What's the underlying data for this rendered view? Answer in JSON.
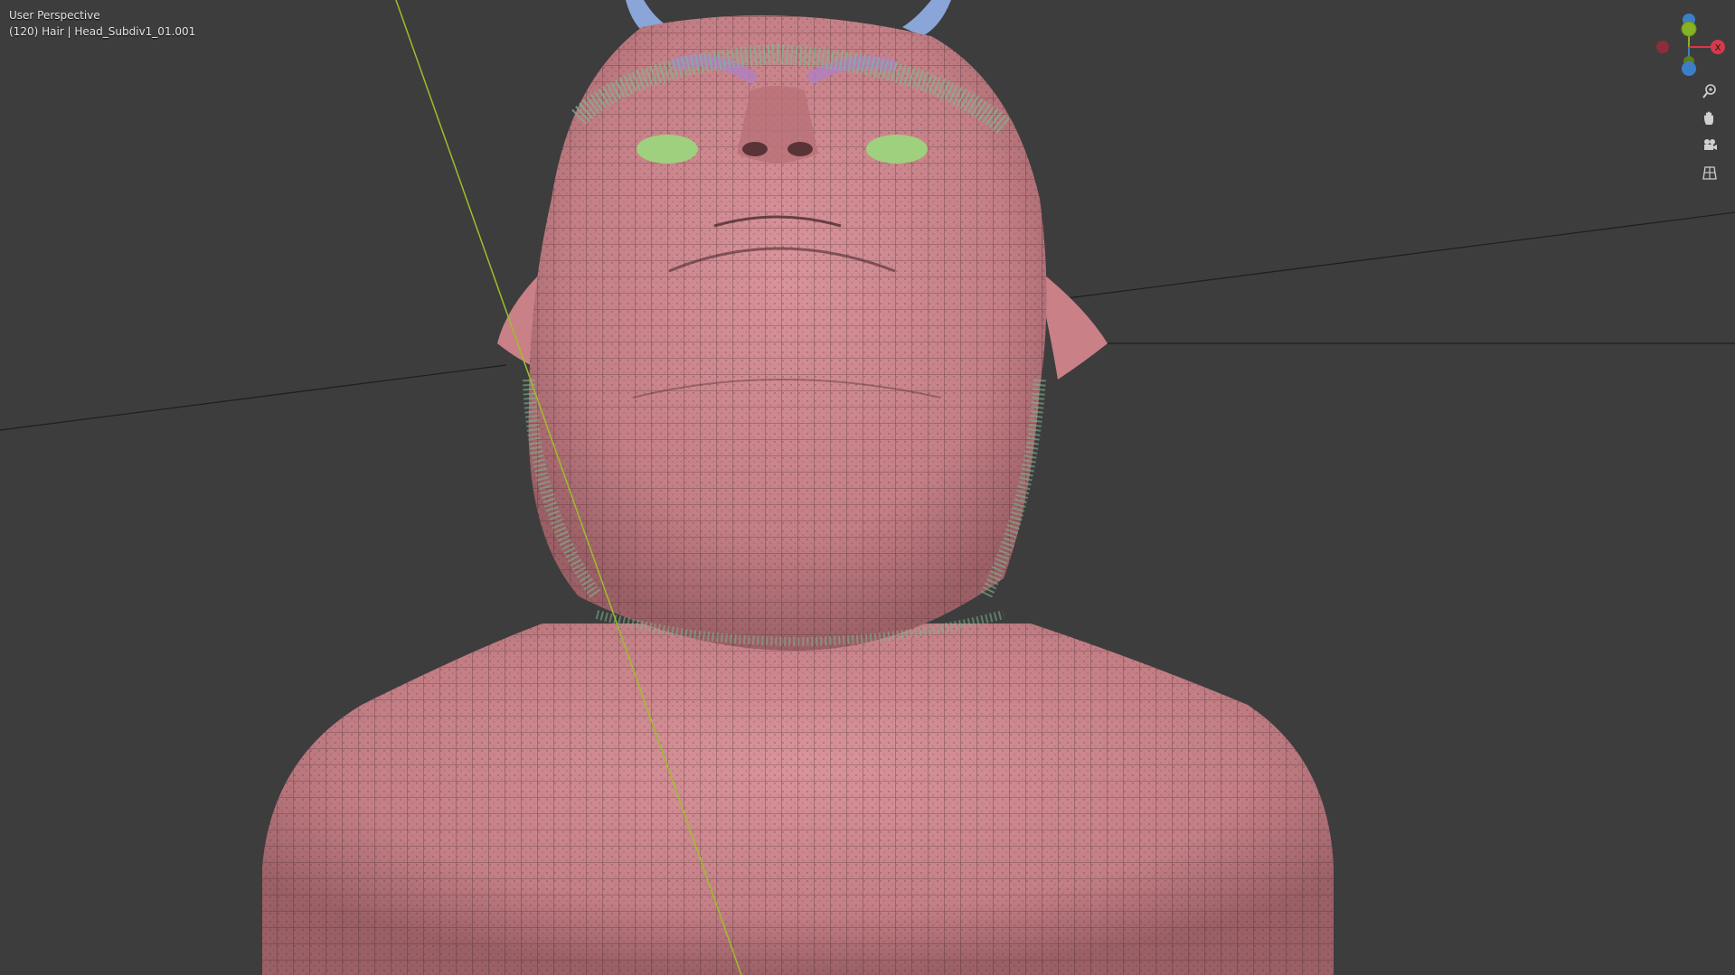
{
  "viewport": {
    "view_name": "User Perspective",
    "object_info": "(120) Hair | Head_Subdiv1_01.001"
  },
  "gizmo": {
    "x_label": "X",
    "colors": {
      "x": "#d9384b",
      "y": "#86b224",
      "z": "#3c7fc9"
    }
  },
  "nav_tools": [
    {
      "name": "zoom-icon"
    },
    {
      "name": "pan-hand-icon"
    },
    {
      "name": "camera-icon"
    },
    {
      "name": "grid-ortho-icon"
    }
  ],
  "colors": {
    "background": "#3d3d3d",
    "skin": "#cc8489",
    "hair": "#7fb58f",
    "eyebrow": "#b07fc3",
    "eye": "#9fd07e",
    "horn": "#8aa6d8",
    "axis_line_y": "#9bbf2a"
  }
}
